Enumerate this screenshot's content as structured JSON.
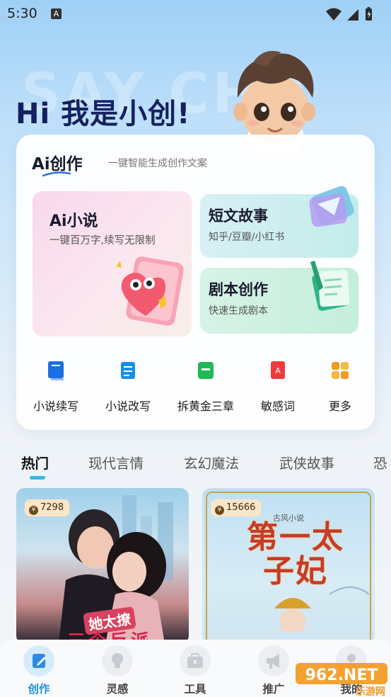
{
  "status_bar": {
    "time": "5:30",
    "notification_glyph": "A"
  },
  "hero": {
    "watermark": "SAY CHU",
    "title": "Hi 我是小创!"
  },
  "ai_card": {
    "brand": "Ai创作",
    "subtitle": "一键智能生成创作文案",
    "novel": {
      "title": "Ai小说",
      "desc": "一键百万字,续写无限制"
    },
    "short_story": {
      "title": "短文故事",
      "desc": "知乎/豆瓣/小红书"
    },
    "script": {
      "title": "剧本创作",
      "desc": "快速生成剧本"
    },
    "tools": [
      {
        "label": "小说续写",
        "icon": "book-blue-icon"
      },
      {
        "label": "小说改写",
        "icon": "document-blue-icon"
      },
      {
        "label": "拆黄金三章",
        "icon": "book-green-icon"
      },
      {
        "label": "敏感词",
        "icon": "book-red-icon"
      },
      {
        "label": "更多",
        "icon": "grid-orange-icon"
      }
    ]
  },
  "tabs": [
    "热门",
    "现代言情",
    "玄幻魔法",
    "武侠故事",
    "恐"
  ],
  "active_tab": "热门",
  "books": [
    {
      "count": "7298",
      "cover_text_1": "她太撩",
      "cover_text_2": "三个反派"
    },
    {
      "count": "15666",
      "cover_label": "古风小说",
      "cover_title": "第一太子妃"
    }
  ],
  "bottom_nav": [
    {
      "label": "创作",
      "icon": "edit-icon",
      "active": true
    },
    {
      "label": "灵感",
      "icon": "lightbulb-icon",
      "active": false
    },
    {
      "label": "工具",
      "icon": "toolbox-icon",
      "active": false
    },
    {
      "label": "推广",
      "icon": "megaphone-icon",
      "active": false
    },
    {
      "label": "我的",
      "icon": "user-icon",
      "active": false
    }
  ],
  "watermark_logo": {
    "main": "962.NET",
    "sub": "乐游网"
  },
  "colors": {
    "accent": "#1e8fe0",
    "tab_indicator": "#38b6e8",
    "hero_title": "#16205e",
    "badge_bg": "#fbe6c8"
  }
}
